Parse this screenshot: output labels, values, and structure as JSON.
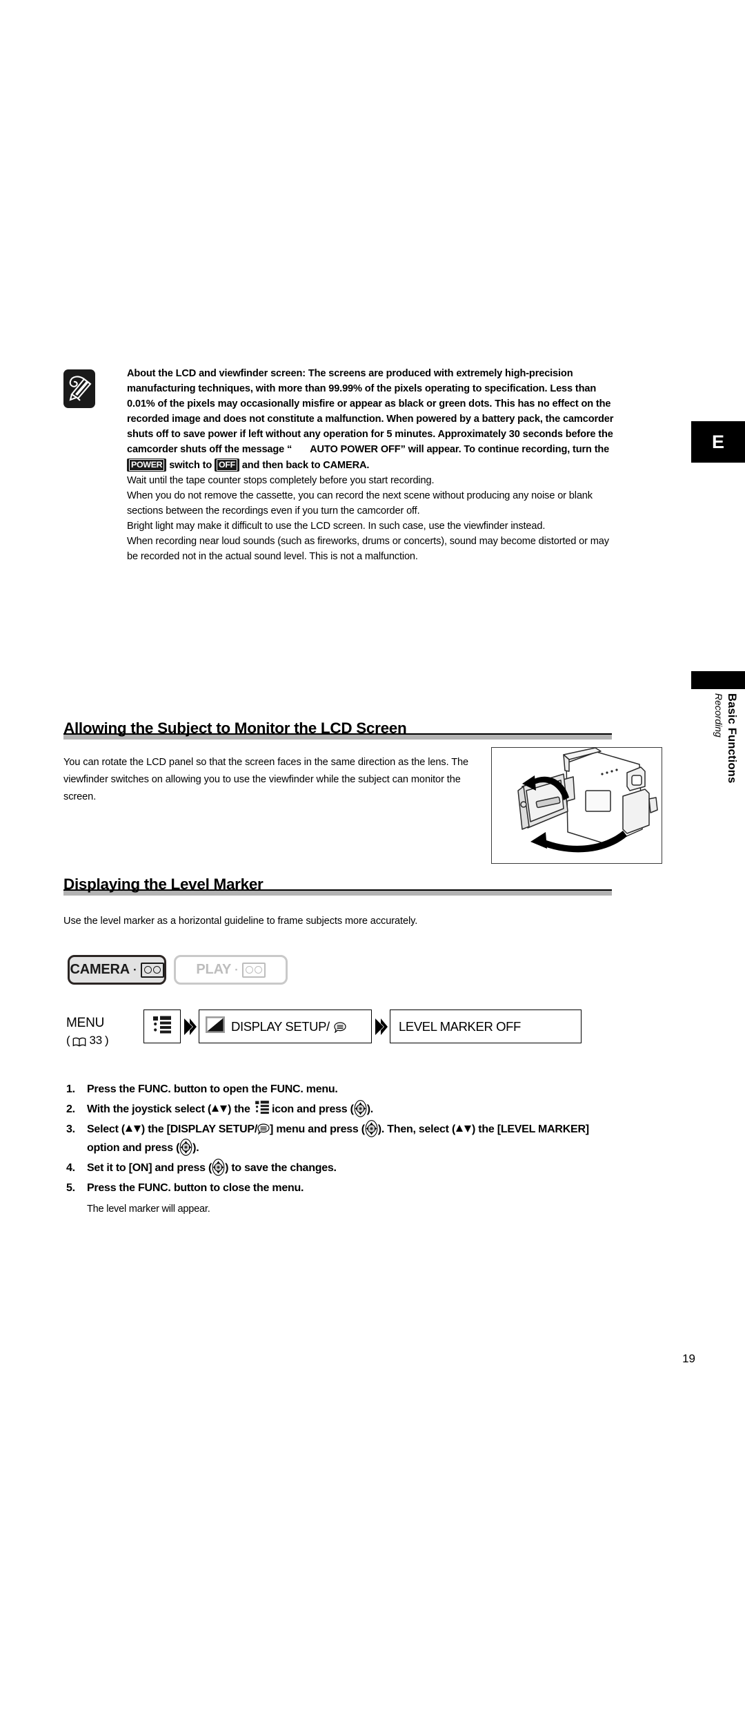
{
  "page": {
    "number": "19",
    "side_tab_letter": "E",
    "side_tab_title": "Basic Functions",
    "side_tab_subtitle": "Recording"
  },
  "note": {
    "icon": "note-pencil-icon",
    "bold_part_1": "About the LCD and viewfinder screen: The screens are produced with extremely high-precision manufacturing techniques, with more than 99.99% of the pixels operating to specification. Less than 0.01% of the pixels may occasionally misfire or appear as black or green dots. This has no effect on the recorded image and does not constitute a malfunction. When powered by a battery pack, the camcorder shuts off to save power if left without any operation for 5 minutes. Approximately 30 seconds before the camcorder shuts off the message “",
    "bold_auto_power_off": "AUTO POWER OFF” will appear. To continue recording, turn the ",
    "badge_power": "POWER",
    "bold_switch_to": " switch to ",
    "badge_off": "OFF",
    "bold_part_end": " and then back to CAMERA.",
    "regular_lines": [
      "Wait until the tape counter stops completely before you start recording.",
      "When you do not remove the cassette, you can record the next scene without producing any noise or blank sections between the recordings even if you turn the camcorder off.",
      "Bright light may make it difficult to use the LCD screen. In such case, use the viewfinder instead.",
      "When recording near loud sounds (such as fireworks, drums or concerts), sound may become distorted or may be recorded not in the actual sound level. This is not a malfunction."
    ]
  },
  "section_lcd": {
    "heading": "Allowing the Subject to Monitor the LCD Screen",
    "paragraph": "You can rotate the LCD panel so that the screen faces in the same direction as the lens. The viewfinder switches on allowing you to use the viewfinder while the subject can monitor the screen.",
    "figure_alt": "camcorder-rotating-lcd-illustration"
  },
  "section_level": {
    "heading": "Displaying the Level Marker",
    "paragraph": "Use the level marker as a horizontal guideline to frame subjects more accurately."
  },
  "mode_buttons": [
    {
      "label": "CAMERA",
      "icon": "tape-cassette-icon",
      "state": "active"
    },
    {
      "label": "PLAY",
      "icon": "tape-cassette-icon",
      "state": "inactive"
    }
  ],
  "menu_flow": {
    "menu_label": "MENU",
    "page_ref_open": "(",
    "page_ref_number": "33",
    "page_ref_close": ")",
    "box1_icon": "menu-list-icon",
    "box2_icon": "display-setup-icon",
    "box2_label": "DISPLAY SETUP/",
    "box2_label_icon": "speech-bubble-icon",
    "box3_label": "LEVEL MARKER OFF",
    "arrow_icon": "double-chevron-right-icon"
  },
  "steps": [
    {
      "num": "1.",
      "text_pre": "Press the FUNC. button to open the FUNC. menu.",
      "text_post": ""
    },
    {
      "num": "2.",
      "text_pre": "With the joystick select (",
      "mid_1": ") the ",
      "mid_2": " icon and press (",
      "text_post": ")."
    },
    {
      "num": "3.",
      "text_pre": "Select (",
      "mid_1": ") the [DISPLAY SETUP/",
      "mid_2": "] menu and press (",
      "mid_3": "). Then, select (",
      "mid_4": ") the [LEVEL MARKER] option and press (",
      "text_post": ")."
    },
    {
      "num": "4.",
      "text_pre": "Set it to [ON] and press (",
      "text_post": ") to save the changes."
    },
    {
      "num": "5.",
      "text_pre": "Press the FUNC. button to close the menu.",
      "text_post": ""
    }
  ],
  "step_note": "The level marker will appear.",
  "colors": {
    "ink": "#000000",
    "rule_gray": "#b3b3b3",
    "badge_bg": "#1a1a1a",
    "disabled_gray": "#bdbdbd",
    "button_fill": "#e2e2e2"
  }
}
